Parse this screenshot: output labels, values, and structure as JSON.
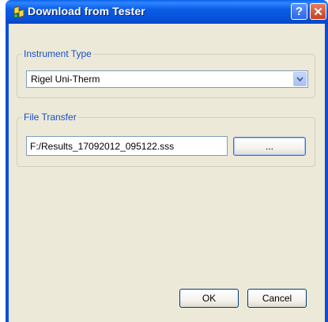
{
  "window": {
    "title": "Download from Tester",
    "help_label": "?",
    "close_label": "✕"
  },
  "instrument_type": {
    "group_label": "Instrument Type",
    "selected": "Rigel Uni-Therm",
    "dropdown_icon": "chevron-down-icon"
  },
  "file_transfer": {
    "group_label": "File Transfer",
    "path_value": "F:/Results_17092012_095122.sss",
    "browse_label": "..."
  },
  "buttons": {
    "ok_label": "OK",
    "cancel_label": "Cancel"
  },
  "colors": {
    "titlebar": "#0a5ce6",
    "client_bg": "#ece9d8",
    "group_label": "#1c4fc4"
  }
}
